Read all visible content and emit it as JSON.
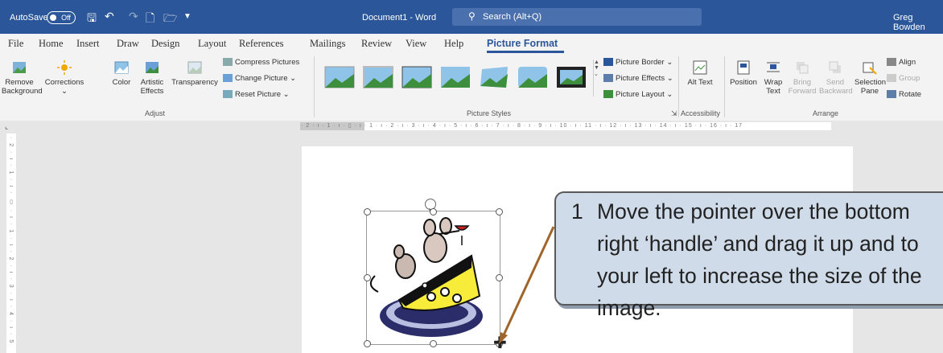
{
  "titlebar": {
    "autosave": "AutoSave",
    "autosave_state": "Off",
    "doc_title": "Document1 - Word",
    "search_placeholder": "Search (Alt+Q)",
    "user": "Greg Bowden"
  },
  "menu": {
    "tabs": [
      "File",
      "Home",
      "Insert",
      "Draw",
      "Design",
      "Layout",
      "References",
      "Mailings",
      "Review",
      "View",
      "Help",
      "Picture Format"
    ],
    "active": "Picture Format"
  },
  "ribbon": {
    "adjust": {
      "remove_background": "Remove Background",
      "corrections": "Corrections",
      "color": "Color",
      "artistic_effects": "Artistic Effects",
      "transparency": "Transparency",
      "compress": "Compress Pictures",
      "change": "Change Picture",
      "reset": "Reset Picture",
      "label": "Adjust"
    },
    "styles": {
      "border": "Picture Border",
      "effects": "Picture Effects",
      "layout": "Picture Layout",
      "label": "Picture Styles"
    },
    "accessibility": {
      "alt_text": "Alt Text",
      "label": "Accessibility"
    },
    "arrange": {
      "position": "Position",
      "wrap_text": "Wrap Text",
      "bring_forward": "Bring Forward",
      "send_backward": "Send Backward",
      "selection_pane": "Selection Pane",
      "align": "Align",
      "group": "Group",
      "rotate": "Rotate",
      "label": "Arrange"
    }
  },
  "callout": {
    "number": "1",
    "text": "Move the pointer over the bottom right ‘handle’ and drag it up and to your left to increase the size of the image."
  },
  "colors": {
    "titlebar": "#2b579a",
    "callout_fill": "#cfdbe8",
    "arrow": "#a0652a"
  }
}
